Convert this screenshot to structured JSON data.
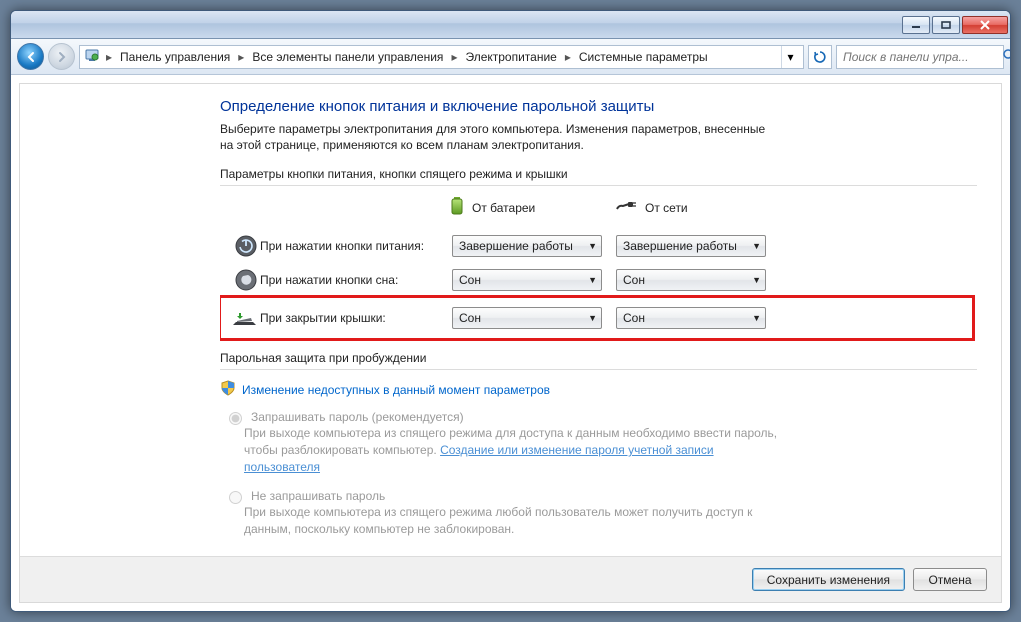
{
  "breadcrumb": {
    "items": [
      "Панель управления",
      "Все элементы панели управления",
      "Электропитание",
      "Системные параметры"
    ]
  },
  "search": {
    "placeholder": "Поиск в панели упра..."
  },
  "page": {
    "title": "Определение кнопок питания и включение парольной защиты",
    "description": "Выберите параметры электропитания для этого компьютера. Изменения параметров, внесенные на этой странице, применяются ко всем планам электропитания."
  },
  "group1": {
    "label": "Параметры кнопки питания, кнопки спящего режима и крышки",
    "col_battery": "От батареи",
    "col_ac": "От сети",
    "rows": [
      {
        "label": "При нажатии кнопки питания:",
        "battery": "Завершение работы",
        "ac": "Завершение работы"
      },
      {
        "label": "При нажатии кнопки сна:",
        "battery": "Сон",
        "ac": "Сон"
      },
      {
        "label": "При закрытии крышки:",
        "battery": "Сон",
        "ac": "Сон"
      }
    ]
  },
  "group2": {
    "label": "Парольная защита при пробуждении",
    "unlock_link": "Изменение недоступных в данный момент параметров",
    "opt1_label": "Запрашивать пароль (рекомендуется)",
    "opt1_desc_a": "При выходе компьютера из спящего режима для доступа к данным необходимо ввести пароль, чтобы разблокировать компьютер. ",
    "opt1_link": "Создание или изменение пароля учетной записи пользователя",
    "opt2_label": "Не запрашивать пароль",
    "opt2_desc": "При выходе компьютера из спящего режима любой пользователь может получить доступ к данным, поскольку компьютер не заблокирован."
  },
  "footer": {
    "save": "Сохранить изменения",
    "cancel": "Отмена"
  }
}
